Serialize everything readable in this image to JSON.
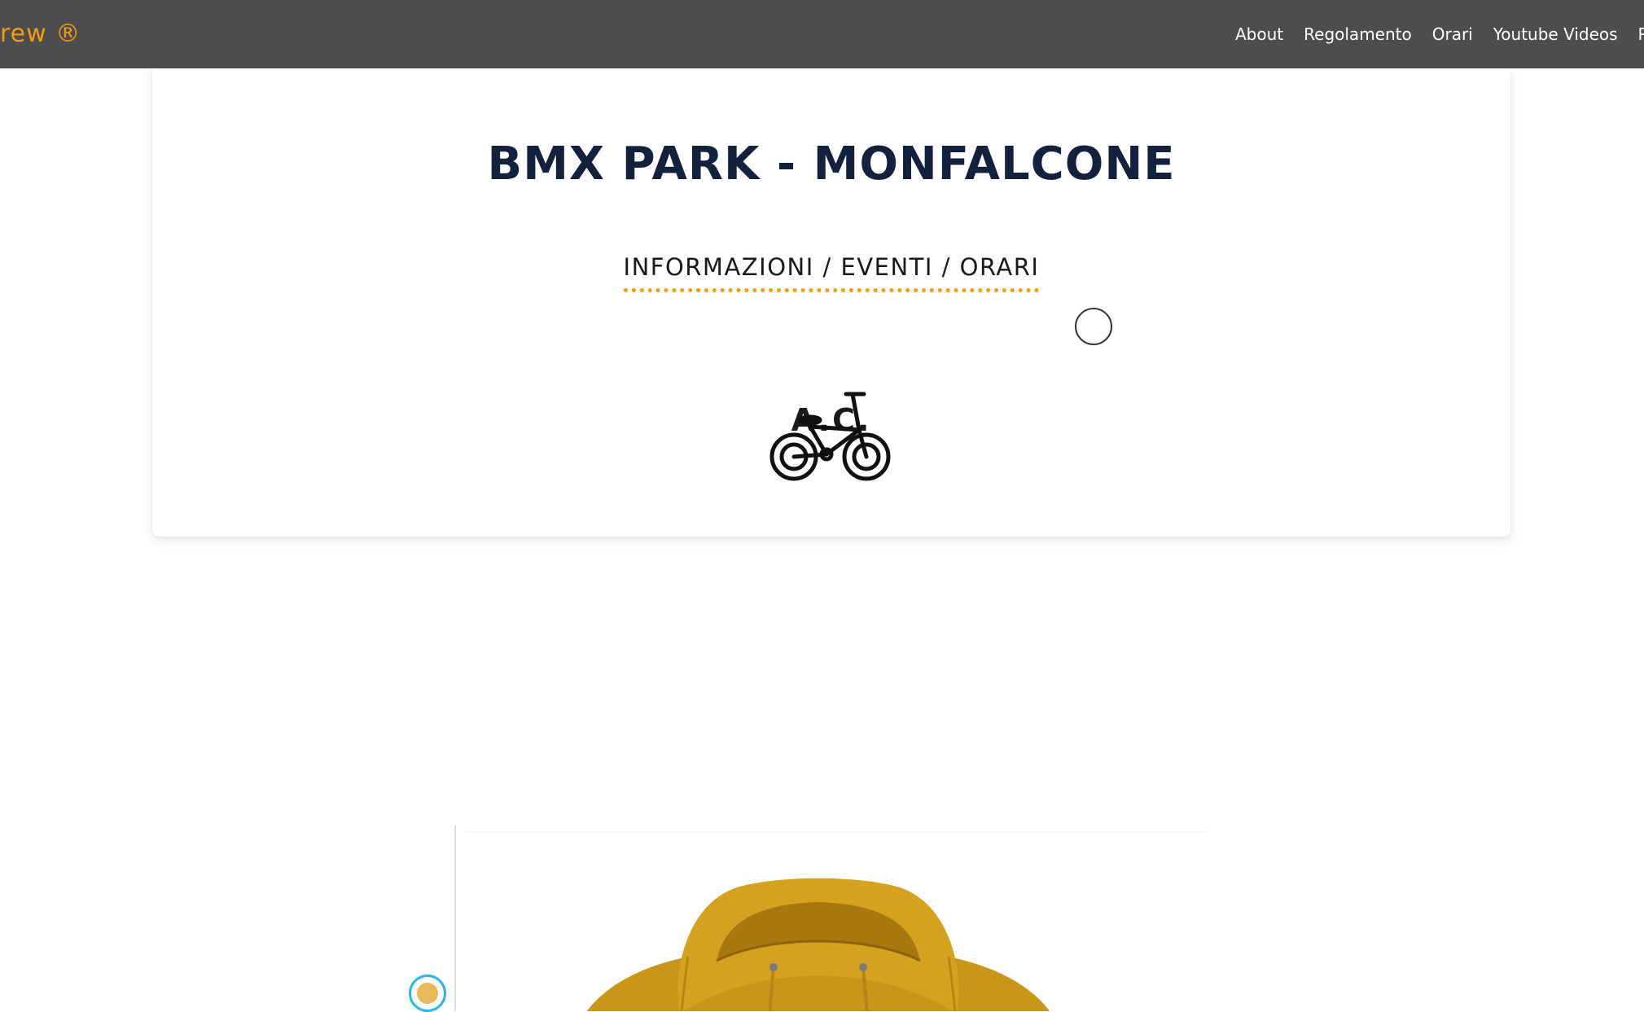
{
  "navbar": {
    "brand": "rew ®",
    "links": [
      {
        "label": "About"
      },
      {
        "label": "Regolamento"
      },
      {
        "label": "Orari"
      },
      {
        "label": "Youtube Videos"
      },
      {
        "label": "Ph"
      }
    ]
  },
  "hero": {
    "title": "BMX PARK - MONFALCONE",
    "subtitle": "INFORMAZIONI / EVENTI / ORARI",
    "ac_label": "A.C.",
    "icon": "bmx-bike-icon"
  },
  "product": {
    "image": "mustard-hoodie",
    "swatch_color": "#e7b95a"
  },
  "colors": {
    "navbar_bg": "#4d4d4d",
    "brand_accent": "#f39c12",
    "title_color": "#14213d",
    "hoodie_color": "#c9961a"
  }
}
